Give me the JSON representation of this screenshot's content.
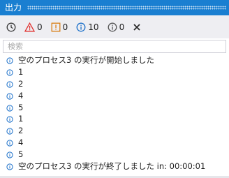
{
  "panel": {
    "title": "出力"
  },
  "toolbar": {
    "error_count": "0",
    "warning_count": "0",
    "info_count": "10",
    "trace_count": "0"
  },
  "search": {
    "placeholder": "検索",
    "value": ""
  },
  "log": [
    "空のプロセス3 の実行が開始しました",
    "1",
    "2",
    "4",
    "5",
    "1",
    "2",
    "4",
    "5",
    "空のプロセス3 の実行が終了しました in: 00:00:01"
  ],
  "colors": {
    "titlebar": "#1a7fd1",
    "toolbar": "#eeeef2",
    "error": "#e0302e",
    "warning": "#d97d12",
    "info": "#1a6fc9",
    "trace": "#555555"
  },
  "icons": {
    "history": "clock-icon",
    "error": "error-triangle-icon",
    "warning": "warning-icon",
    "info": "info-icon",
    "trace": "trace-info-icon",
    "clear": "clear-icon",
    "log_item": "info-circle-icon"
  }
}
